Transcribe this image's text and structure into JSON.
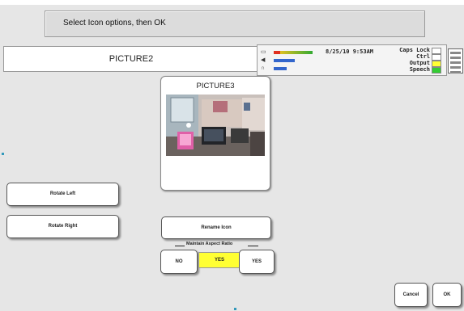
{
  "prompt": {
    "text": "Select Icon options, then OK"
  },
  "header": {
    "title": "PICTURE2"
  },
  "status": {
    "datetime": "8/25/10 9:53AM",
    "keys": [
      {
        "label": "Caps Lock",
        "color": "#ffffff"
      },
      {
        "label": "Ctrl",
        "color": "#ffffff"
      },
      {
        "label": "Output",
        "color": "#ffff33"
      },
      {
        "label": "Speech",
        "color": "#33cc33"
      }
    ],
    "meter_icons": [
      "headset-icon",
      "speaker-icon",
      "headphones-icon"
    ]
  },
  "card": {
    "title": "PICTURE3"
  },
  "buttons": {
    "rotate_left": "Rotate Left",
    "rotate_right": "Rotate Right",
    "rename": "Rename Icon",
    "no": "NO",
    "yes_selected": "YES",
    "yes": "YES",
    "cancel": "Cancel",
    "ok": "OK"
  },
  "aspect_group": {
    "label": "Maintain Aspect Ratio"
  },
  "colors": {
    "background": "#e6e6e6",
    "selected": "#ffff33",
    "meter_red": "#e03020",
    "meter_green": "#33aa33",
    "meter_blue": "#3366cc"
  }
}
